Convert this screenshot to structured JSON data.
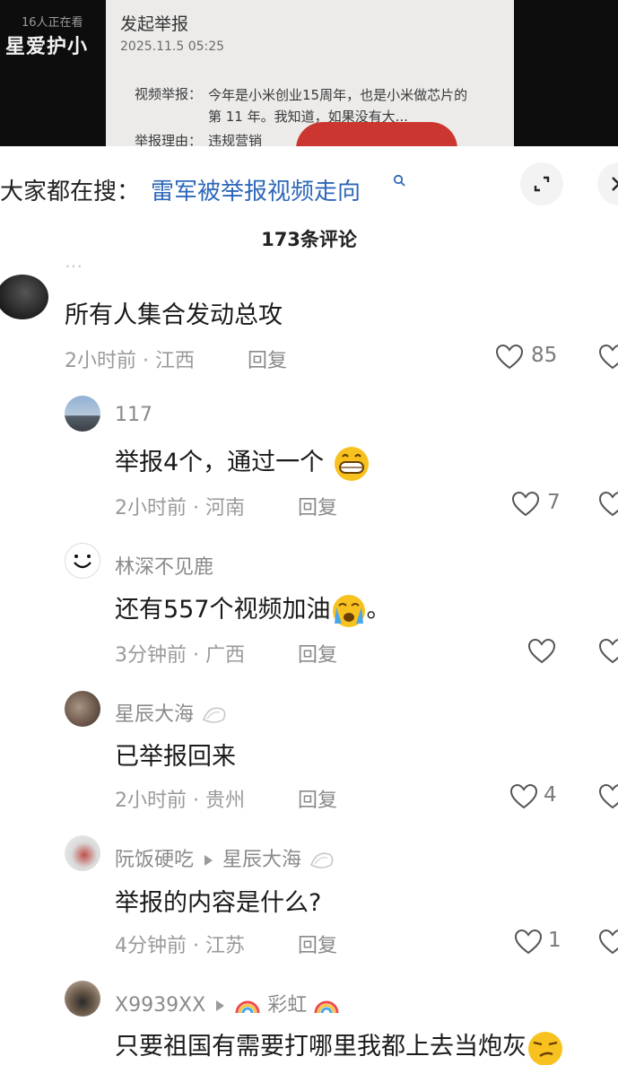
{
  "video": {
    "viewers_text": "16人正在看",
    "live_title": "星爱护小",
    "doc_title": "发起举报",
    "doc_date": "2025.11.5 05:25",
    "doc_line1_label": "视频举报：",
    "doc_line1_text": "今年是小米创业15周年，也是小米做芯片的第 11 年。我知道，如果没有大...",
    "doc_line3_label": "举报理由：",
    "doc_line3_text": "违规营销"
  },
  "search": {
    "prefix": "大家都在搜：",
    "query": "雷军被举报视频走向",
    "search_icon": "search-icon"
  },
  "header": {
    "comment_count": "173条评论",
    "expand_icon": "expand-icon",
    "close_icon": "close-icon"
  },
  "comments": [
    {
      "partial_name": "…",
      "text": "所有人集合发动总攻",
      "time": "2小时前",
      "location": "江西",
      "reply": "回复",
      "likes": "85"
    },
    {
      "name": "117",
      "text": "举报4个，通过一个",
      "emoji": "grinning-face",
      "time": "2小时前",
      "location": "河南",
      "reply": "回复",
      "likes": "7"
    },
    {
      "name": "林深不见鹿",
      "text": "还有557个视频加油",
      "emoji": "crying-face",
      "suffix": "。",
      "time": "3分钟前",
      "location": "广西",
      "reply": "回复",
      "likes": ""
    },
    {
      "name": "星辰大海",
      "text": "已举报回来",
      "time": "2小时前",
      "location": "贵州",
      "reply": "回复",
      "likes": "4"
    },
    {
      "name": "阮饭硬吃",
      "reply_to": "星辰大海",
      "text": "举报的内容是什么?",
      "time": "4分钟前",
      "location": "江苏",
      "reply": "回复",
      "likes": "1"
    },
    {
      "name": "X9939XX",
      "reply_to": "彩虹",
      "text": "只要祖国有需要打哪里我都上去当炮灰",
      "emoji": "smirking-face"
    }
  ],
  "dot": "·",
  "colors": {
    "link": "#2e67b9",
    "muted": "#9a9a9a",
    "emoji": "#f7c21f"
  }
}
